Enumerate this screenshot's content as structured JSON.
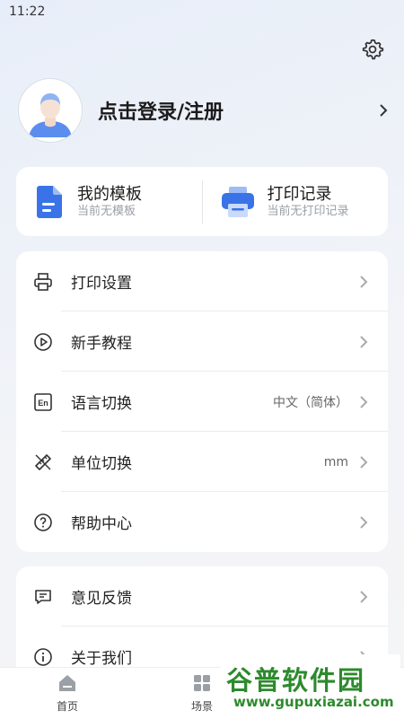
{
  "status": {
    "time": "11:22"
  },
  "profile": {
    "login_text": "点击登录/注册"
  },
  "quick": {
    "templates": {
      "title": "我的模板",
      "subtitle": "当前无模板"
    },
    "records": {
      "title": "打印记录",
      "subtitle": "当前无打印记录"
    }
  },
  "menu": [
    {
      "label": "打印设置",
      "icon": "printer-icon",
      "value": ""
    },
    {
      "label": "新手教程",
      "icon": "play-icon",
      "value": ""
    },
    {
      "label": "语言切换",
      "icon": "language-icon",
      "value": "中文（简体）"
    },
    {
      "label": "单位切换",
      "icon": "ruler-icon",
      "value": "mm"
    },
    {
      "label": "帮助中心",
      "icon": "help-icon",
      "value": ""
    }
  ],
  "menu2": [
    {
      "label": "意见反馈",
      "icon": "feedback-icon"
    },
    {
      "label": "关于我们",
      "icon": "info-icon"
    }
  ],
  "tabs": {
    "home": "首页",
    "scene": "场景"
  },
  "watermark": {
    "top": "谷普软件园",
    "bottom": "www.gupuxiazai.com"
  },
  "colors": {
    "accent": "#3a73e8",
    "watermark_green": "#2d8a2d",
    "watermark_blue": "#1d6fd8"
  }
}
